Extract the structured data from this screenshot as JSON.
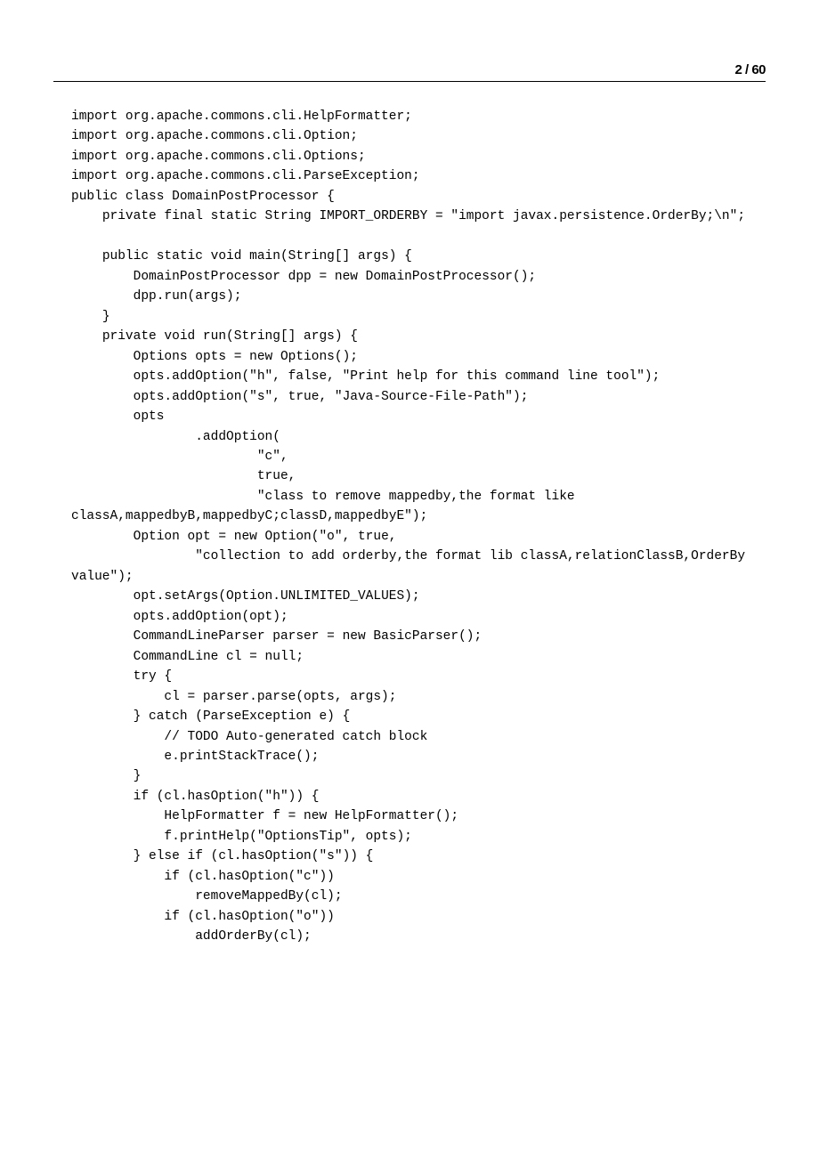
{
  "pageNumber": "2",
  "pageSeparator": "/",
  "totalPages": "60",
  "code": {
    "lines": [
      "import org.apache.commons.cli.HelpFormatter;",
      "import org.apache.commons.cli.Option;",
      "import org.apache.commons.cli.Options;",
      "import org.apache.commons.cli.ParseException;",
      "public class DomainPostProcessor {",
      "    private final static String IMPORT_ORDERBY = \"import javax.persistence.OrderBy;\\n\";",
      "",
      "    public static void main(String[] args) {",
      "        DomainPostProcessor dpp = new DomainPostProcessor();",
      "        dpp.run(args);",
      "    }",
      "    private void run(String[] args) {",
      "        Options opts = new Options();",
      "        opts.addOption(\"h\", false, \"Print help for this command line tool\");",
      "        opts.addOption(\"s\", true, \"Java-Source-File-Path\");",
      "        opts",
      "                .addOption(",
      "                        \"c\",",
      "                        true,",
      "                        \"class to remove mappedby,the format like classA,mappedbyB,mappedbyC;classD,mappedbyE\");",
      "        Option opt = new Option(\"o\", true,",
      "                \"collection to add orderby,the format lib classA,relationClassB,OrderBy value\");",
      "        opt.setArgs(Option.UNLIMITED_VALUES);",
      "        opts.addOption(opt);",
      "        CommandLineParser parser = new BasicParser();",
      "        CommandLine cl = null;",
      "        try {",
      "            cl = parser.parse(opts, args);",
      "        } catch (ParseException e) {",
      "            // TODO Auto-generated catch block",
      "            e.printStackTrace();",
      "        }",
      "        if (cl.hasOption(\"h\")) {",
      "            HelpFormatter f = new HelpFormatter();",
      "            f.printHelp(\"OptionsTip\", opts);",
      "        } else if (cl.hasOption(\"s\")) {",
      "            if (cl.hasOption(\"c\"))",
      "                removeMappedBy(cl);",
      "            if (cl.hasOption(\"o\"))",
      "                addOrderBy(cl);"
    ]
  }
}
